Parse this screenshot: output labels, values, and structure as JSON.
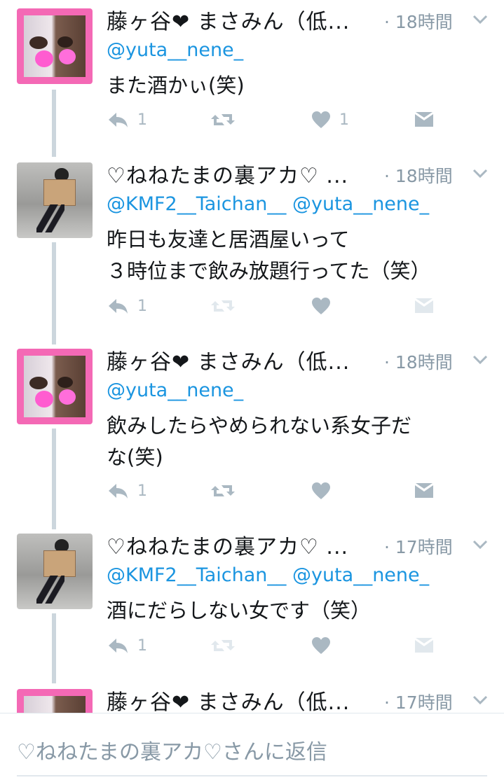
{
  "tweets": [
    {
      "avatar": "pink-couple-avatar",
      "name": "藤ヶ谷❤︎ まさみん（低...",
      "time": "· 18時間",
      "reply_to": "@yuta__nene_",
      "lines": [
        "また酒かぃ(笑)"
      ],
      "reply_count": "1",
      "retweet_count": "",
      "like_count": "1"
    },
    {
      "avatar": "gray-photo-avatar",
      "name": "♡ねねたまの裏アカ♡ ...",
      "time": "· 18時間",
      "reply_to": "@KMF2__Taichan__ @yuta__nene_",
      "lines": [
        "昨日も友達と居酒屋いって",
        "３時位まで飲み放題行ってた（笑）"
      ],
      "reply_count": "1",
      "retweet_count": "",
      "like_count": ""
    },
    {
      "avatar": "pink-couple-avatar",
      "name": "藤ヶ谷❤︎ まさみん（低...",
      "time": "· 18時間",
      "reply_to": "@yuta__nene_",
      "lines": [
        "飲みしたらやめられない系女子だ",
        "な(笑)"
      ],
      "reply_count": "1",
      "retweet_count": "",
      "like_count": ""
    },
    {
      "avatar": "gray-photo-avatar",
      "name": "♡ねねたまの裏アカ♡ ...",
      "time": "· 17時間",
      "reply_to": "@KMF2__Taichan__ @yuta__nene_",
      "lines": [
        "酒にだらしない女です（笑）"
      ],
      "reply_count": "1",
      "retweet_count": "",
      "like_count": ""
    },
    {
      "avatar": "pink-couple-avatar",
      "name": "藤ヶ谷❤︎ まさみん（低...",
      "time": "· 17時間",
      "reply_to": "",
      "lines": [],
      "reply_count": "",
      "retweet_count": "",
      "like_count": ""
    }
  ],
  "reply_composer": {
    "placeholder": "♡ねねたまの裏アカ♡さんに返信"
  },
  "colors": {
    "text": "#14171a",
    "meta": "#8899a6",
    "link": "#1b95e0",
    "icon": "#aab8c2",
    "thread_line": "#ccd6dd",
    "avatar_pink": "#f469b5"
  }
}
